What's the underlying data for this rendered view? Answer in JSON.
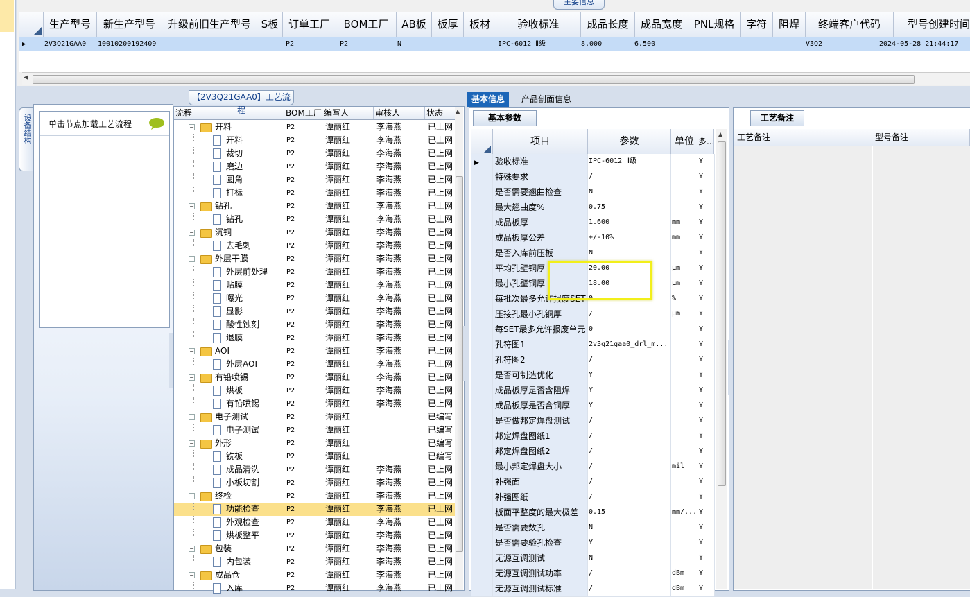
{
  "top_panel": {
    "section_title": "主要信息",
    "columns": [
      "生产型号",
      "新生产型号",
      "升级前旧生产型号",
      "S板",
      "订单工厂",
      "BOM工厂",
      "AB板",
      "板厚",
      "板材",
      "验收标准",
      "成品长度",
      "成品宽度",
      "PNL规格",
      "字符",
      "阻焊",
      "终端客户代码",
      "型号创建时间"
    ],
    "row": {
      "model": "2V3Q21GAA0",
      "new_model": "10010200192409",
      "old_model": "",
      "s_board": "",
      "order_factory": "P2",
      "bom_factory": "P2",
      "ab_board": "N",
      "thickness": "",
      "material": "",
      "standard": "IPC-6012 Ⅱ级",
      "length": "8.000",
      "width": "6.500",
      "pnl": "",
      "char": "",
      "solder": "",
      "customer": "V3Q2",
      "created": "2024-05-28 21:44:17"
    }
  },
  "side": {
    "vtab_label": "设备结构",
    "load_hint": "单击节点加载工艺流程"
  },
  "process": {
    "title": "【2V3Q21GAA0】工艺流程",
    "columns": [
      "流程",
      "BOM工厂",
      "编写人",
      "审核人",
      "状态"
    ],
    "rows": [
      {
        "level": 0,
        "name": "开料",
        "bom": "P2",
        "writer": "谭丽红",
        "reviewer": "李海燕",
        "status": "已上网"
      },
      {
        "level": 1,
        "name": "开料",
        "bom": "P2",
        "writer": "谭丽红",
        "reviewer": "李海燕",
        "status": "已上网"
      },
      {
        "level": 1,
        "name": "裁切",
        "bom": "P2",
        "writer": "谭丽红",
        "reviewer": "李海燕",
        "status": "已上网"
      },
      {
        "level": 1,
        "name": "磨边",
        "bom": "P2",
        "writer": "谭丽红",
        "reviewer": "李海燕",
        "status": "已上网"
      },
      {
        "level": 1,
        "name": "圆角",
        "bom": "P2",
        "writer": "谭丽红",
        "reviewer": "李海燕",
        "status": "已上网"
      },
      {
        "level": 1,
        "name": "打标",
        "bom": "P2",
        "writer": "谭丽红",
        "reviewer": "李海燕",
        "status": "已上网"
      },
      {
        "level": 0,
        "name": "钻孔",
        "bom": "P2",
        "writer": "谭丽红",
        "reviewer": "李海燕",
        "status": "已上网"
      },
      {
        "level": 1,
        "name": "钻孔",
        "bom": "P2",
        "writer": "谭丽红",
        "reviewer": "李海燕",
        "status": "已上网"
      },
      {
        "level": 0,
        "name": "沉铜",
        "bom": "P2",
        "writer": "谭丽红",
        "reviewer": "李海燕",
        "status": "已上网"
      },
      {
        "level": 1,
        "name": "去毛刺",
        "bom": "P2",
        "writer": "谭丽红",
        "reviewer": "李海燕",
        "status": "已上网"
      },
      {
        "level": 0,
        "name": "外层干膜",
        "bom": "P2",
        "writer": "谭丽红",
        "reviewer": "李海燕",
        "status": "已上网"
      },
      {
        "level": 1,
        "name": "外层前处理",
        "bom": "P2",
        "writer": "谭丽红",
        "reviewer": "李海燕",
        "status": "已上网"
      },
      {
        "level": 1,
        "name": "贴膜",
        "bom": "P2",
        "writer": "谭丽红",
        "reviewer": "李海燕",
        "status": "已上网"
      },
      {
        "level": 1,
        "name": "曝光",
        "bom": "P2",
        "writer": "谭丽红",
        "reviewer": "李海燕",
        "status": "已上网"
      },
      {
        "level": 1,
        "name": "显影",
        "bom": "P2",
        "writer": "谭丽红",
        "reviewer": "李海燕",
        "status": "已上网"
      },
      {
        "level": 1,
        "name": "酸性蚀刻",
        "bom": "P2",
        "writer": "谭丽红",
        "reviewer": "李海燕",
        "status": "已上网"
      },
      {
        "level": 1,
        "name": "退膜",
        "bom": "P2",
        "writer": "谭丽红",
        "reviewer": "李海燕",
        "status": "已上网"
      },
      {
        "level": 0,
        "name": "AOI",
        "bom": "P2",
        "writer": "谭丽红",
        "reviewer": "李海燕",
        "status": "已上网"
      },
      {
        "level": 1,
        "name": "外层AOI",
        "bom": "P2",
        "writer": "谭丽红",
        "reviewer": "李海燕",
        "status": "已上网"
      },
      {
        "level": 0,
        "name": "有铅喷锡",
        "bom": "P2",
        "writer": "谭丽红",
        "reviewer": "李海燕",
        "status": "已上网"
      },
      {
        "level": 1,
        "name": "烘板",
        "bom": "P2",
        "writer": "谭丽红",
        "reviewer": "李海燕",
        "status": "已上网"
      },
      {
        "level": 1,
        "name": "有铅喷锡",
        "bom": "P2",
        "writer": "谭丽红",
        "reviewer": "李海燕",
        "status": "已上网"
      },
      {
        "level": 0,
        "name": "电子测试",
        "bom": "P2",
        "writer": "谭丽红",
        "reviewer": "",
        "status": "已编写"
      },
      {
        "level": 1,
        "name": "电子测试",
        "bom": "P2",
        "writer": "谭丽红",
        "reviewer": "",
        "status": "已编写"
      },
      {
        "level": 0,
        "name": "外形",
        "bom": "P2",
        "writer": "谭丽红",
        "reviewer": "",
        "status": "已编写"
      },
      {
        "level": 1,
        "name": "铣板",
        "bom": "P2",
        "writer": "谭丽红",
        "reviewer": "",
        "status": "已编写"
      },
      {
        "level": 1,
        "name": "成品清洗",
        "bom": "P2",
        "writer": "谭丽红",
        "reviewer": "李海燕",
        "status": "已上网"
      },
      {
        "level": 1,
        "name": "小板切割",
        "bom": "P2",
        "writer": "谭丽红",
        "reviewer": "李海燕",
        "status": "已上网"
      },
      {
        "level": 0,
        "name": "终检",
        "bom": "P2",
        "writer": "谭丽红",
        "reviewer": "李海燕",
        "status": "已上网"
      },
      {
        "level": 1,
        "name": "功能检查",
        "bom": "P2",
        "writer": "谭丽红",
        "reviewer": "李海燕",
        "status": "已上网",
        "selected": true
      },
      {
        "level": 1,
        "name": "外观检查",
        "bom": "P2",
        "writer": "谭丽红",
        "reviewer": "李海燕",
        "status": "已上网"
      },
      {
        "level": 1,
        "name": "烘板整平",
        "bom": "P2",
        "writer": "谭丽红",
        "reviewer": "李海燕",
        "status": "已上网"
      },
      {
        "level": 0,
        "name": "包装",
        "bom": "P2",
        "writer": "谭丽红",
        "reviewer": "李海燕",
        "status": "已上网"
      },
      {
        "level": 1,
        "name": "内包装",
        "bom": "P2",
        "writer": "谭丽红",
        "reviewer": "李海燕",
        "status": "已上网"
      },
      {
        "level": 0,
        "name": "成品仓",
        "bom": "P2",
        "writer": "谭丽红",
        "reviewer": "李海燕",
        "status": "已上网"
      },
      {
        "level": 1,
        "name": "入库",
        "bom": "P2",
        "writer": "谭丽红",
        "reviewer": "李海燕",
        "status": "已上网"
      }
    ]
  },
  "right_tabs": [
    "基本信息",
    "产品剖面信息"
  ],
  "basic": {
    "tab_label": "基本参数",
    "columns": [
      "项目",
      "参数",
      "单位",
      "多..."
    ],
    "rows": [
      {
        "item": "验收标准",
        "value": "IPC-6012 Ⅱ级",
        "unit": "",
        "req": "Y"
      },
      {
        "item": "特殊要求",
        "value": "/",
        "unit": "",
        "req": "Y"
      },
      {
        "item": "是否需要翘曲检查",
        "value": "N",
        "unit": "",
        "req": "Y"
      },
      {
        "item": "最大翘曲度%",
        "value": "0.75",
        "unit": "",
        "req": "Y"
      },
      {
        "item": "成品板厚",
        "value": "1.600",
        "unit": "mm",
        "req": "Y"
      },
      {
        "item": "成品板厚公差",
        "value": "+/-10%",
        "unit": "mm",
        "req": "Y"
      },
      {
        "item": "是否入库前压板",
        "value": "N",
        "unit": "",
        "req": "Y"
      },
      {
        "item": "平均孔壁铜厚",
        "value": "20.00",
        "unit": "μm",
        "req": "Y"
      },
      {
        "item": "最小孔壁铜厚",
        "value": "18.00",
        "unit": "μm",
        "req": "Y"
      },
      {
        "item": "每批次最多允许报废SET",
        "value": "0",
        "unit": "%",
        "req": "Y"
      },
      {
        "item": "压接孔最小孔铜厚",
        "value": "/",
        "unit": "μm",
        "req": "Y"
      },
      {
        "item": "每SET最多允许报废单元",
        "value": "0",
        "unit": "",
        "req": "Y"
      },
      {
        "item": "孔符图1",
        "value": "2v3q21gaa0_drl_m...",
        "unit": "",
        "req": "Y"
      },
      {
        "item": "孔符图2",
        "value": "/",
        "unit": "",
        "req": "Y"
      },
      {
        "item": "是否可制造优化",
        "value": "Y",
        "unit": "",
        "req": "Y"
      },
      {
        "item": "成品板厚是否含阻焊",
        "value": "Y",
        "unit": "",
        "req": "Y"
      },
      {
        "item": "成品板厚是否含铜厚",
        "value": "Y",
        "unit": "",
        "req": "Y"
      },
      {
        "item": "是否做邦定焊盘测试",
        "value": "/",
        "unit": "",
        "req": "Y"
      },
      {
        "item": "邦定焊盘图纸1",
        "value": "/",
        "unit": "",
        "req": "Y"
      },
      {
        "item": "邦定焊盘图纸2",
        "value": "/",
        "unit": "",
        "req": "Y"
      },
      {
        "item": "最小邦定焊盘大小",
        "value": "/",
        "unit": "mil",
        "req": "Y"
      },
      {
        "item": "补强面",
        "value": "/",
        "unit": "",
        "req": "Y"
      },
      {
        "item": "补强图纸",
        "value": "/",
        "unit": "",
        "req": "Y"
      },
      {
        "item": "板面平整度的最大极差",
        "value": "0.15",
        "unit": "mm/...",
        "req": "Y"
      },
      {
        "item": "是否需要数孔",
        "value": "N",
        "unit": "",
        "req": "Y"
      },
      {
        "item": "是否需要验孔检查",
        "value": "Y",
        "unit": "",
        "req": "Y"
      },
      {
        "item": "无源互调测试",
        "value": "N",
        "unit": "",
        "req": "Y"
      },
      {
        "item": "无源互调测试功率",
        "value": "/",
        "unit": "dBm",
        "req": "Y"
      },
      {
        "item": "无源互调测试标准",
        "value": "/",
        "unit": "dBm",
        "req": "Y"
      }
    ]
  },
  "craft": {
    "tab_label": "工艺备注",
    "col1": "工艺备注",
    "col2": "型号备注"
  }
}
